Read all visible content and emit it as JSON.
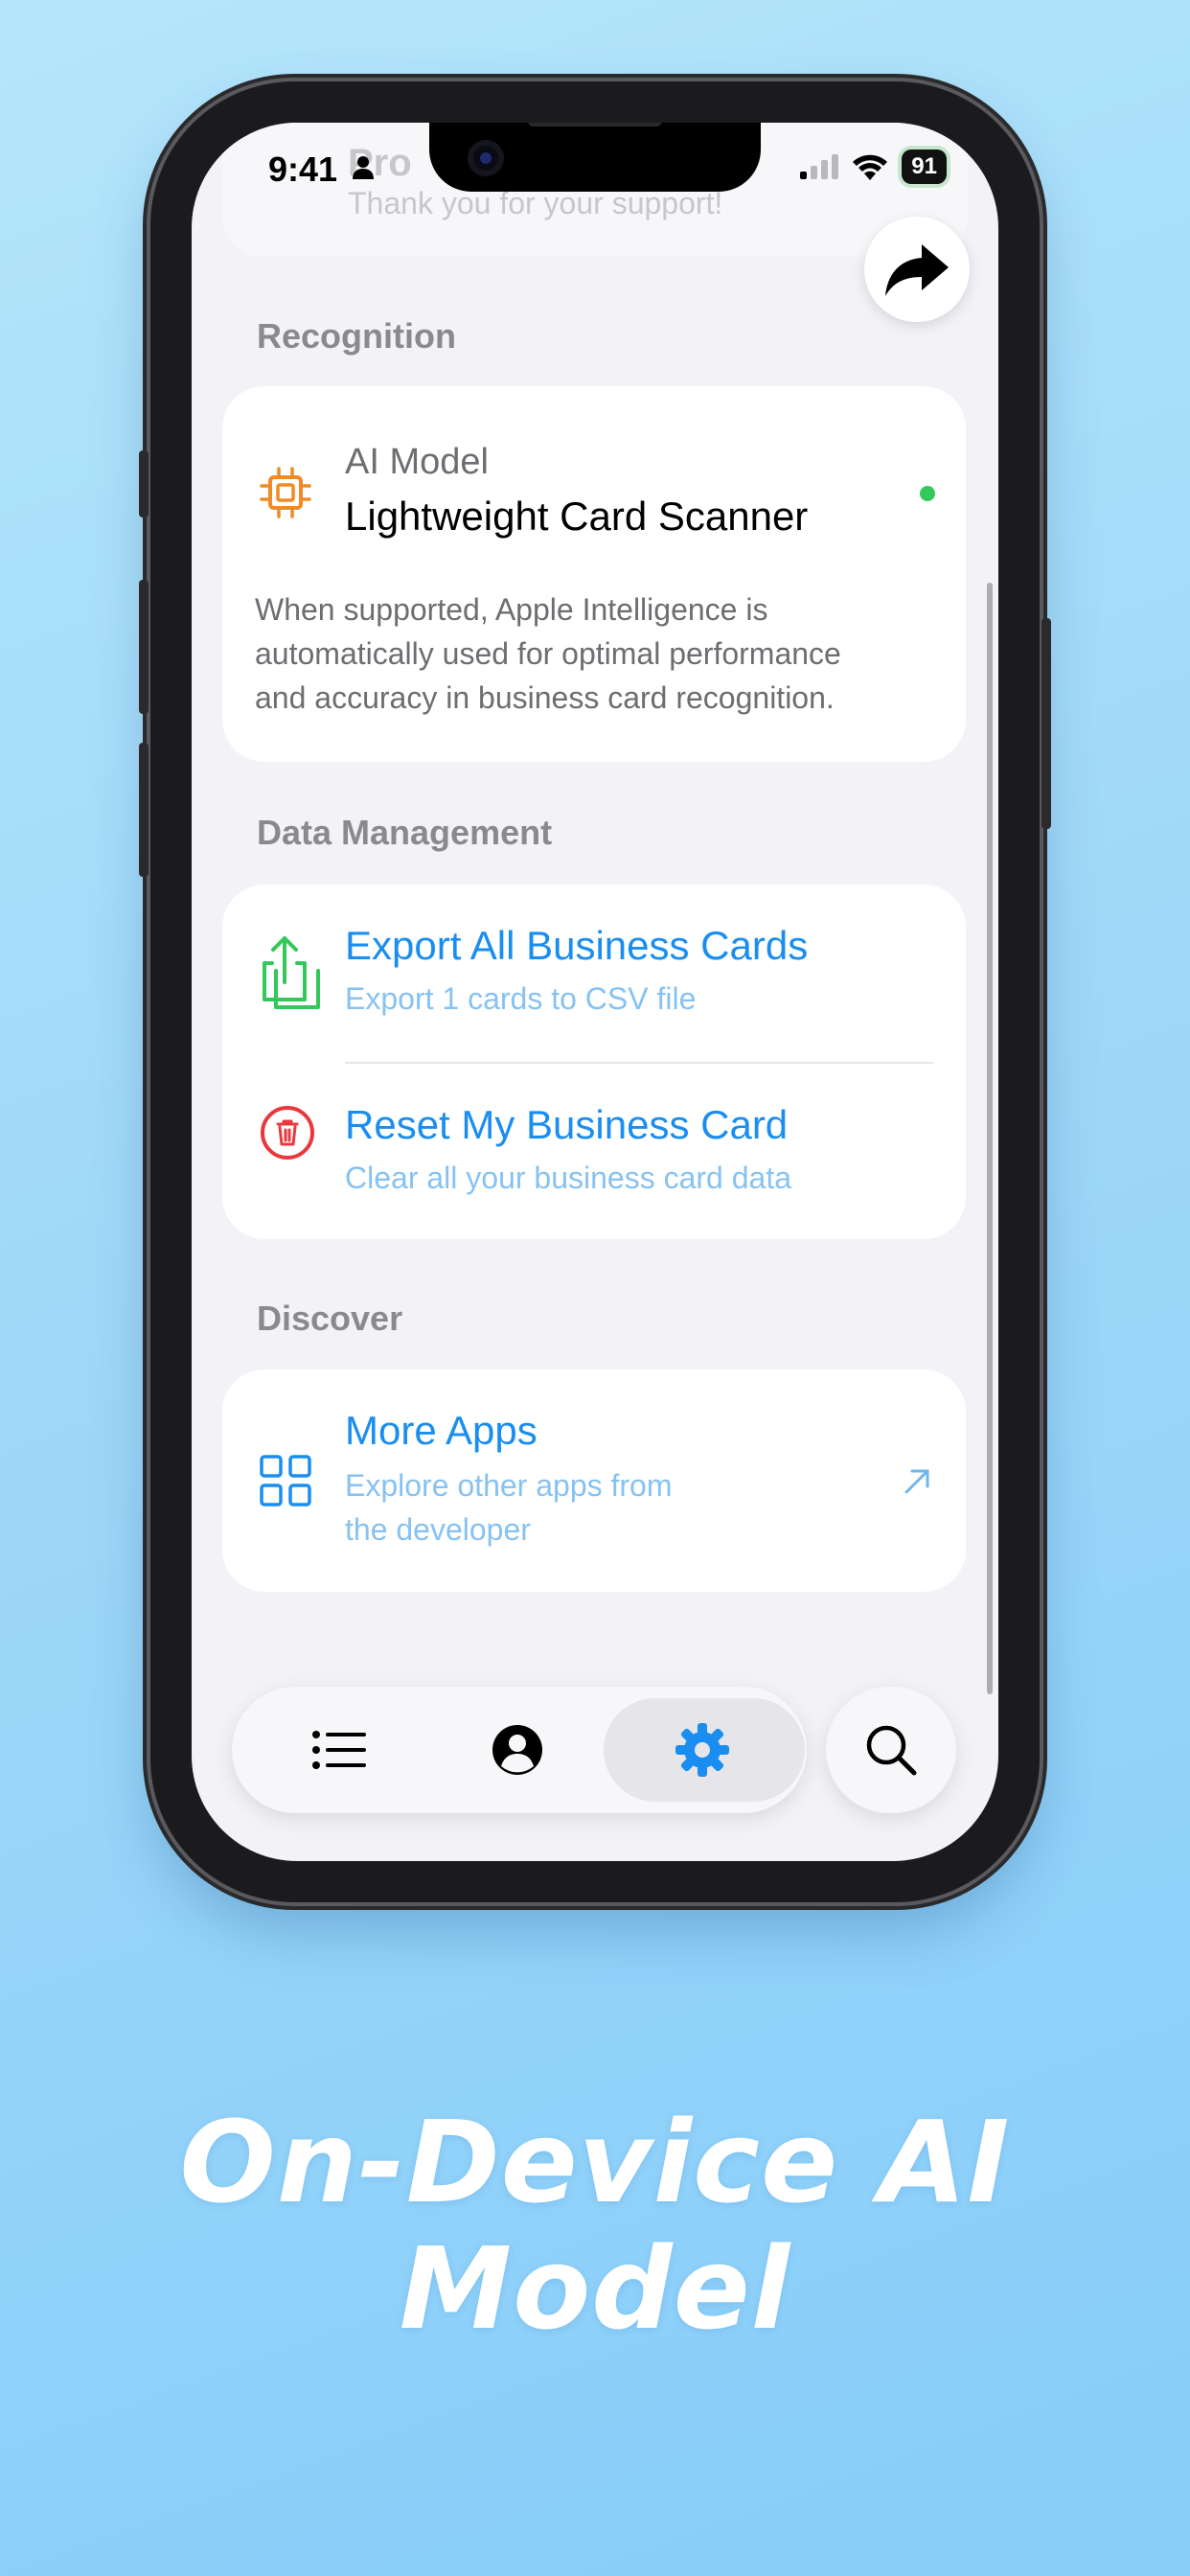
{
  "status_bar": {
    "time": "9:41",
    "battery": "91"
  },
  "top_ghost": {
    "title": "Pro",
    "subtitle": "Thank you for your support!"
  },
  "recognition": {
    "header": "Recognition",
    "model_label": "AI Model",
    "model_name": "Lightweight Card Scanner",
    "status_color": "#34c759",
    "description_line1": "When supported, Apple Intelligence is",
    "description_line2": "automatically used for optimal performance",
    "description_line3": "and accuracy in business card recognition."
  },
  "data_management": {
    "header": "Data Management",
    "export_title": "Export All Business Cards",
    "export_subtitle": "Export 1 cards to CSV file",
    "reset_title": "Reset My Business Card",
    "reset_subtitle": "Clear all your business card data"
  },
  "discover": {
    "header": "Discover",
    "more_apps_title": "More Apps",
    "more_apps_line1": "Explore other apps from",
    "more_apps_line2": "the developer"
  },
  "tabbar": {
    "active_tab": "settings",
    "accent": "#1a8ef0"
  },
  "colors": {
    "accent": "#1a8ef0",
    "export_icon": "#34c759",
    "reset_icon": "#e8383d",
    "ai_icon": "#f08a24"
  },
  "headline": {
    "line1": "On-Device AI",
    "line2": "Model"
  }
}
